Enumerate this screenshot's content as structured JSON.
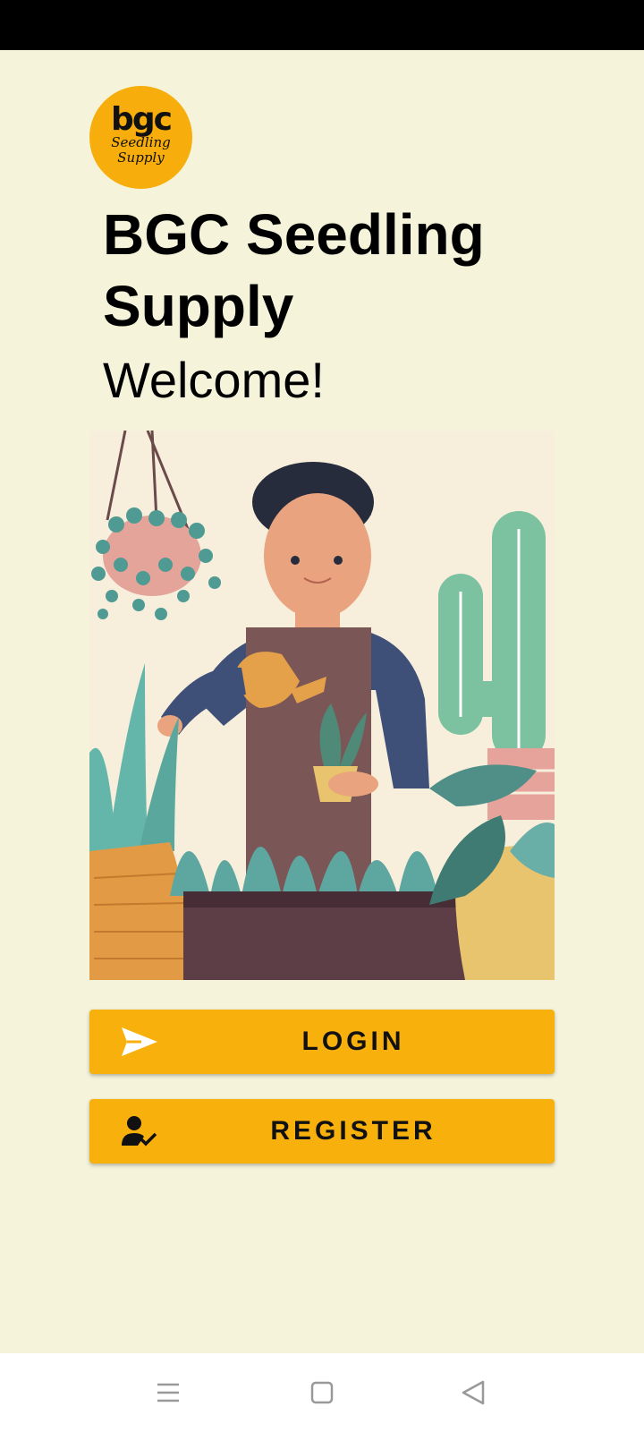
{
  "logo": {
    "main": "bgc",
    "sub_line1": "Seedling",
    "sub_line2": "Supply"
  },
  "header": {
    "title": "BGC Seedling Supply",
    "subtitle": "Welcome!"
  },
  "actions": {
    "login_label": "LOGIN",
    "login_icon": "send-icon",
    "register_label": "REGISTER",
    "register_icon": "person-check-icon"
  },
  "nav": {
    "menu_icon": "menu-icon",
    "home_icon": "square-home-icon",
    "back_icon": "triangle-back-icon"
  },
  "colors": {
    "background": "#f5f4db",
    "accent": "#f8b00c"
  }
}
